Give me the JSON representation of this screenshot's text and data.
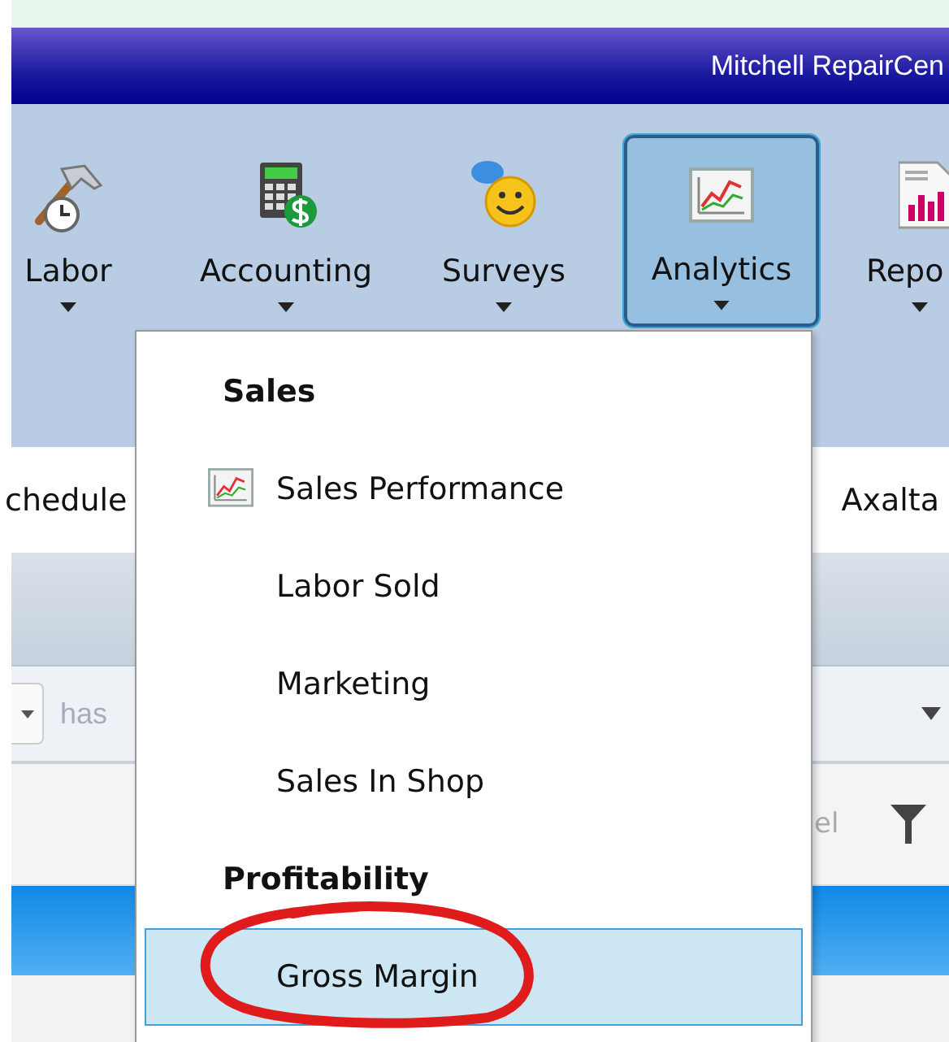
{
  "title_bar": {
    "title": "Mitchell RepairCen"
  },
  "ribbon": {
    "buttons": [
      {
        "label": "Labor",
        "kind": "labor",
        "selected": false
      },
      {
        "label": "Accounting",
        "kind": "accounting",
        "selected": false
      },
      {
        "label": "Surveys",
        "kind": "surveys",
        "selected": false
      },
      {
        "label": "Analytics",
        "kind": "analytics",
        "selected": true
      },
      {
        "label": "Repo",
        "kind": "report",
        "selected": false
      }
    ]
  },
  "tab_strip": {
    "items": [
      "chedule",
      "Axalta"
    ]
  },
  "filter_row": {
    "placeholder": "has"
  },
  "grid": {
    "column_header": "el"
  },
  "menu": {
    "items": [
      {
        "kind": "header",
        "label": "Sales"
      },
      {
        "kind": "item",
        "label": "Sales Performance",
        "icon": true,
        "selected": false
      },
      {
        "kind": "item",
        "label": "Labor Sold",
        "icon": false,
        "selected": false
      },
      {
        "kind": "item",
        "label": "Marketing",
        "icon": false,
        "selected": false
      },
      {
        "kind": "item",
        "label": "Sales In Shop",
        "icon": false,
        "selected": false
      },
      {
        "kind": "header",
        "label": "Profitability"
      },
      {
        "kind": "item",
        "label": "Gross Margin",
        "icon": false,
        "selected": true
      }
    ]
  }
}
